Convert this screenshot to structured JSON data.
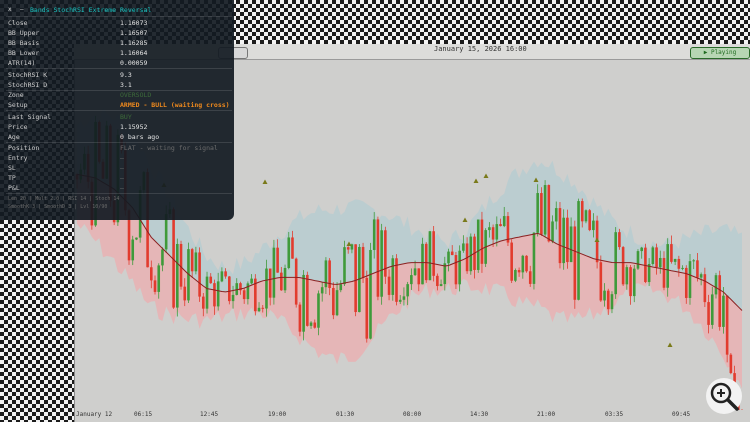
{
  "panel": {
    "close_label": "x",
    "min_label": "–",
    "title": "Bands StochRSI Extreme Reversal",
    "rows": [
      {
        "key": "Close",
        "value": "1.16073"
      },
      {
        "key": "BB Upper",
        "value": "1.16507"
      },
      {
        "key": "BB Basis",
        "value": "1.16285"
      },
      {
        "key": "BB Lower",
        "value": "1.16064"
      },
      {
        "key": "ATR(14)",
        "value": "0.00059"
      },
      {
        "key": "StochRSI K",
        "value": "9.3"
      },
      {
        "key": "StochRSI D",
        "value": "3.1"
      },
      {
        "key": "Zone",
        "value": "OVERSOLD"
      },
      {
        "key": "Setup",
        "value": "ARMED - BULL (waiting cross)"
      },
      {
        "key": "Last Signal",
        "value": "BUY"
      },
      {
        "key": "Price",
        "value": "1.15952"
      },
      {
        "key": "Age",
        "value": "0 bars ago"
      },
      {
        "key": "Position",
        "value": "FLAT - waiting for signal"
      },
      {
        "key": "Entry",
        "value": "–"
      },
      {
        "key": "SL",
        "value": "–"
      },
      {
        "key": "TP",
        "value": "–"
      },
      {
        "key": "P&L",
        "value": "–"
      }
    ],
    "footer1": "Len 20 | Mult 2.0 | RSI 14 | Stoch 14",
    "footer2": "SmoothK 3 | SmoothD 3 | Lvl 10/90"
  },
  "chart_header": {
    "date": "January 15, 2026   16:00",
    "playing_label": "▶ Playing"
  },
  "xaxis_labels": [
    "January 12",
    "06:15",
    "12:45",
    "19:00",
    "01:30",
    "08:00",
    "14:30",
    "21:00",
    "03:35",
    "09:45"
  ],
  "colors": {
    "accent": "#18c3c0",
    "setup": "#f08a1d",
    "bull": "#3f9a3a",
    "bear": "#e23b2e",
    "basis": "#8a2020"
  },
  "icons": {
    "zoom": "zoom-in-icon"
  },
  "chart_data": {
    "type": "candlestick",
    "basis": [
      1.1649,
      1.1648,
      1.1645,
      1.164,
      1.1632,
      1.1627,
      1.1622,
      1.1618,
      1.1617,
      1.1618,
      1.162,
      1.1621,
      1.1621,
      1.162,
      1.1619,
      1.162,
      1.1622,
      1.1624,
      1.1625,
      1.1625,
      1.1624,
      1.1626,
      1.1629,
      1.1631,
      1.1632,
      1.1633,
      1.163,
      1.1628,
      1.1626,
      1.1625,
      1.1625,
      1.1624,
      1.1623,
      1.1622,
      1.162,
      1.1617,
      1.1612
    ]
  }
}
